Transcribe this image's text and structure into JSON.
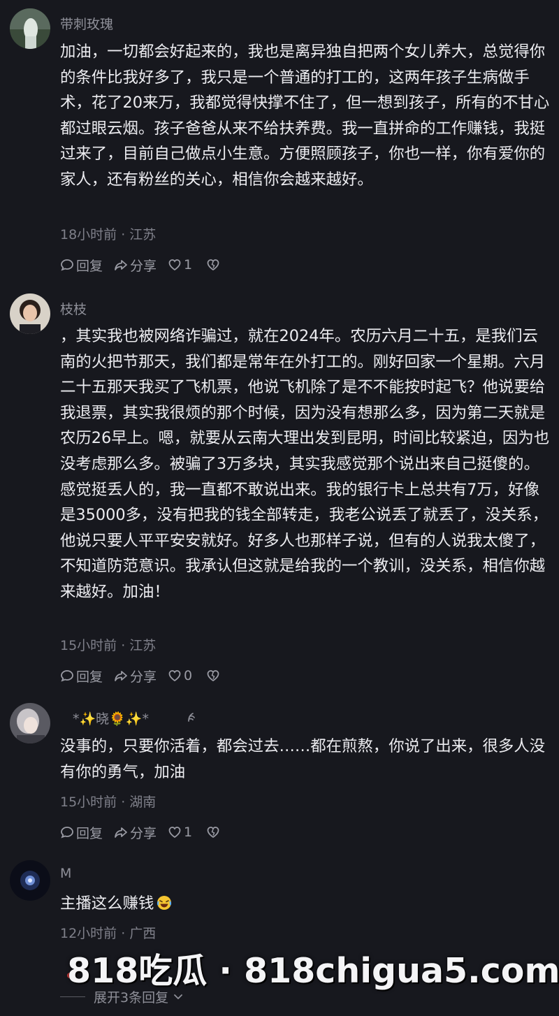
{
  "comments": [
    {
      "username": "带刺玫瑰",
      "text": "加油，一切都会好起来的，我也是离异独自把两个女儿养大，总觉得你的条件比我好多了，我只是一个普通的打工的，这两年孩子生病做手术，花了20来万，我都觉得快撑不住了，但一想到孩子，所有的不甘心都过眼云烟。孩子爸爸从来不给扶养费。我一直拼命的工作赚钱，我挺过来了，目前自己做点小生意。方便照顾孩子，你也一样，你有爱你的家人，还有粉丝的关心，相信你会越来越好。",
      "meta": "18小时前 · 江苏",
      "reply_label": "回复",
      "share_label": "分享",
      "like_count": "1"
    },
    {
      "username": "枝枝",
      "text": "，其实我也被网络诈骗过，就在2024年。农历六月二十五，是我们云南的火把节那天，我们都是常年在外打工的。刚好回家一个星期。六月二十五那天我买了飞机票，他说飞机除了是不不能按时起飞？他说要给我退票，其实我很烦的那个时候，因为没有想那么多，因为第二天就是农历26早上。嗯，就要从云南大理出发到昆明，时间比较紧迫，因为也没考虑那么多。被骗了3万多块，其实我感觉那个说出来自己挺傻的。感觉挺丢人的，我一直都不敢说出来。我的银行卡上总共有7万，好像是35000多，没有把我的钱全部转走，我老公说丢了就丢了，没关系，他说只要人平平安安就好。好多人也那样子说，但有的人说我太傻了，不知道防范意识。我承认但这就是给我的一个教训，没关系，相信你越来越好。加油！",
      "meta": "15小时前 · 江苏",
      "reply_label": "回复",
      "share_label": "分享",
      "like_count": "0"
    },
    {
      "username": "*✨晓🌻✨*",
      "text": "没事的，只要你活着，都会过去……都在煎熬，你说了出来，很多人没有你的勇气，加油",
      "meta": "15小时前 · 湖南",
      "reply_label": "回复",
      "share_label": "分享",
      "like_count": "1"
    },
    {
      "username": "M",
      "text": "主播这么赚钱",
      "meta": "12小时前 · 广西"
    }
  ],
  "expand_replies": "展开3条回复",
  "watermark": "818吃瓜 · 818chigua5.com",
  "colors": {
    "background": "#17181e",
    "text": "#ececf0",
    "muted": "#7f808a"
  }
}
